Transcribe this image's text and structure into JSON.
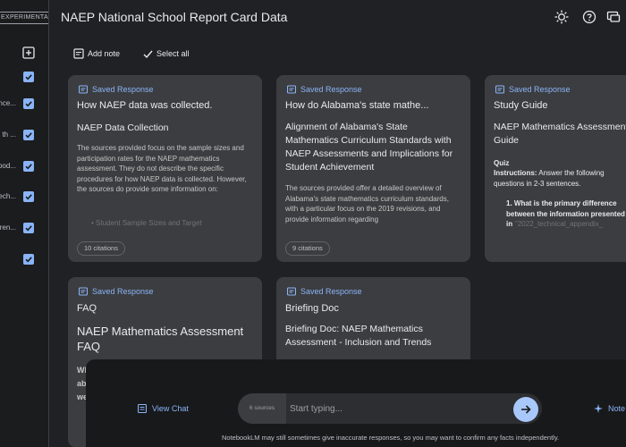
{
  "app": {
    "badge": "EXPERIMENTAL",
    "title": "NAEP National School Report Card Data"
  },
  "sidebar": {
    "sources": [
      {
        "label": "",
        "checked": true
      },
      {
        "label": "nce...",
        "checked": true
      },
      {
        "label": "th ...",
        "checked": true
      },
      {
        "label": "ood...",
        "checked": true
      },
      {
        "label": "ech...",
        "checked": true
      },
      {
        "label": "ren...",
        "checked": true
      },
      {
        "label": "",
        "checked": true
      }
    ]
  },
  "header": {
    "icons": [
      "theme-icon",
      "help-icon",
      "feedback-icon",
      "settings-icon"
    ]
  },
  "toolbar": {
    "add_note": "Add note",
    "select_all": "Select all"
  },
  "cards": [
    {
      "tag": "Saved Response",
      "title": "How NAEP data was collected.",
      "heading": "NAEP Data Collection",
      "body": "The sources provided focus on the sample sizes and participation rates for the NAEP mathematics assessment. They do not describe the specific procedures for how NAEP data is collected. However, the sources do provide some information on:",
      "bullet": "Student Sample Sizes and Target",
      "citations": "10 citations"
    },
    {
      "tag": "Saved Response",
      "title": "How do Alabama's state mathe...",
      "heading": "Alignment of Alabama's State Mathematics Curriculum Standards with NAEP Assessments and Implications for Student Achievement",
      "body": "The sources provided offer a detailed overview of Alabama's state mathematics curriculum standards, with a particular focus on the 2019 revisions, and provide information regarding",
      "citations": "9 citations"
    },
    {
      "tag": "Saved Response",
      "title": "Study Guide",
      "heading": "NAEP Mathematics Assessment Guide",
      "quiz_label": "Quiz",
      "instructions_label": "Instructions:",
      "instructions": "Answer the following questions in 2-3 sentences.",
      "q1": "1. What is the primary difference between the information presented in",
      "q1_source": "\"2022_technical_appendix_"
    },
    {
      "tag": "Saved Response",
      "title": "FAQ",
      "heading": "NAEP Mathematics Assessment FAQ",
      "snippet": [
        "Wh",
        "ab",
        "we"
      ]
    },
    {
      "tag": "Saved Response",
      "title": "Briefing Doc",
      "heading": "Briefing Doc: NAEP Mathematics Assessment - Inclusion and Trends"
    }
  ],
  "chat": {
    "view_chat": "View Chat",
    "sources_count": "6 sources",
    "placeholder": "Start typing...",
    "notebook_tab": "Note",
    "disclaimer": "NotebookLM may still sometimes give inaccurate responses, so you may want to confirm any facts independently."
  },
  "colors": {
    "accent": "#8ab4f8",
    "card_bg": "#3c3d40",
    "page_bg": "#202124"
  }
}
